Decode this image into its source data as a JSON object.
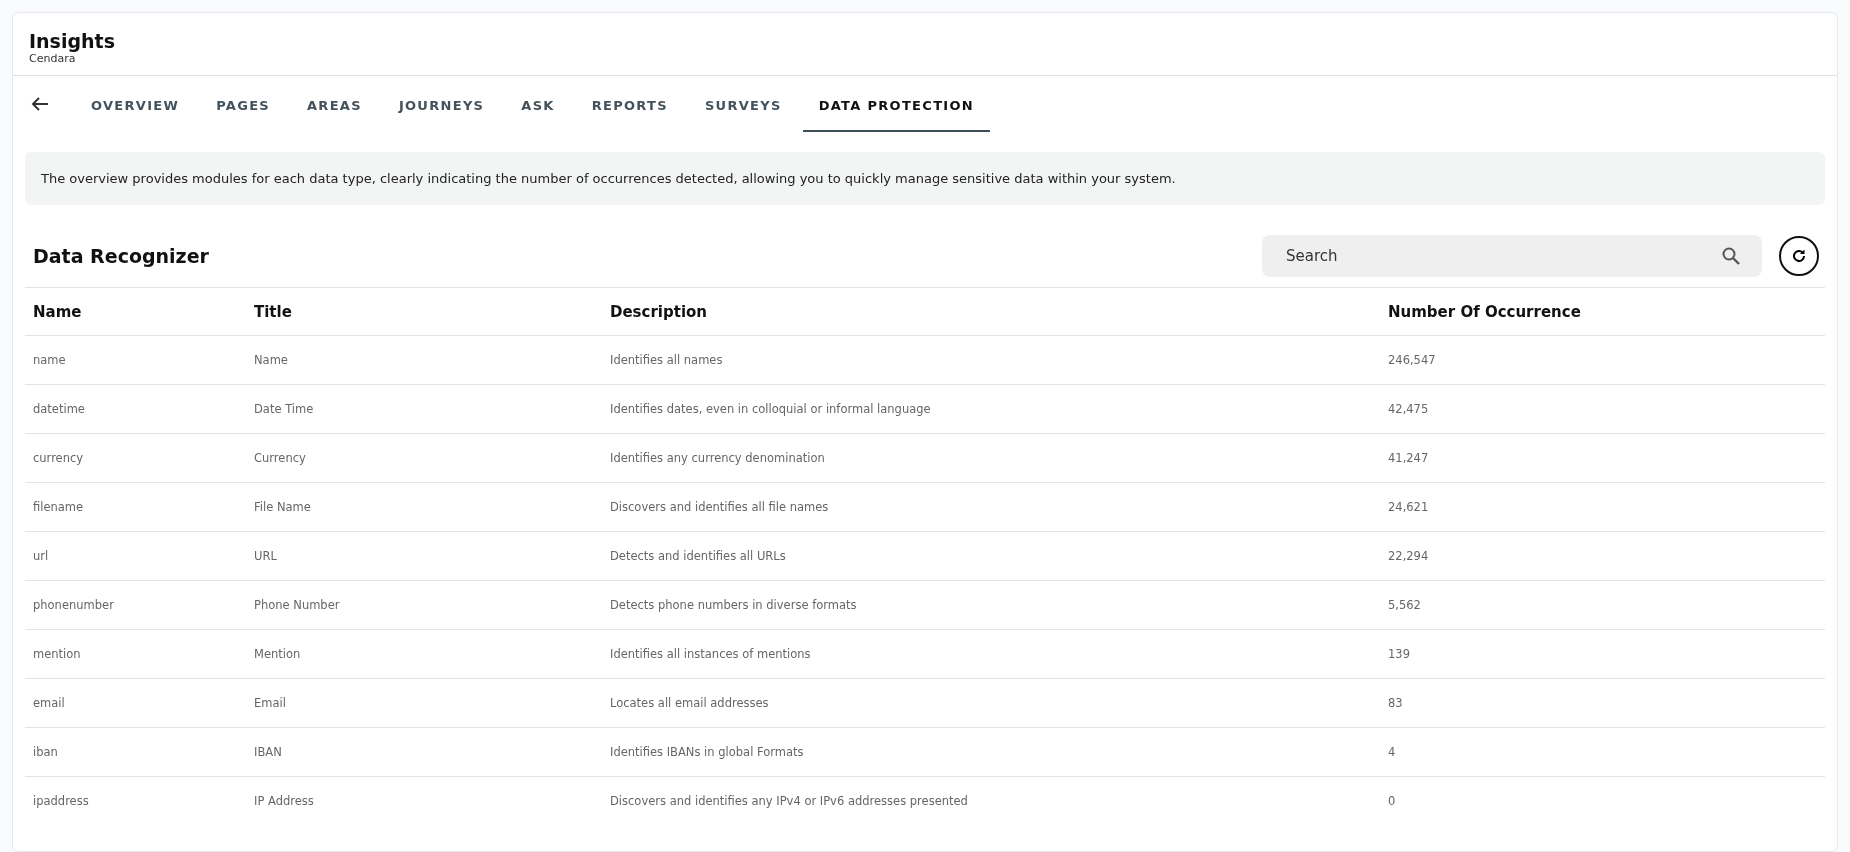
{
  "header": {
    "title": "Insights",
    "subtitle": "Cendara"
  },
  "tabs": [
    {
      "label": "OVERVIEW",
      "selected": false
    },
    {
      "label": "PAGES",
      "selected": false
    },
    {
      "label": "AREAS",
      "selected": false
    },
    {
      "label": "JOURNEYS",
      "selected": false
    },
    {
      "label": "ASK",
      "selected": false
    },
    {
      "label": "REPORTS",
      "selected": false
    },
    {
      "label": "SURVEYS",
      "selected": false
    },
    {
      "label": "DATA PROTECTION",
      "selected": true
    }
  ],
  "info": "The overview provides modules for each data type, clearly indicating the number of occurrences detected, allowing you to quickly manage sensitive data within your system.",
  "section_title": "Data Recognizer",
  "search": {
    "placeholder": "Search"
  },
  "table": {
    "columns": [
      "Name",
      "Title",
      "Description",
      "Number Of Occurrence"
    ],
    "rows": [
      [
        "name",
        "Name",
        "Identifies all names",
        "246,547"
      ],
      [
        "datetime",
        "Date Time",
        "Identifies dates, even in colloquial or informal language",
        "42,475"
      ],
      [
        "currency",
        "Currency",
        "Identifies any currency denomination",
        "41,247"
      ],
      [
        "filename",
        "File Name",
        "Discovers and identifies all file names",
        "24,621"
      ],
      [
        "url",
        "URL",
        "Detects and identifies all URLs",
        "22,294"
      ],
      [
        "phonenumber",
        "Phone Number",
        "Detects phone numbers in diverse formats",
        "5,562"
      ],
      [
        "mention",
        "Mention",
        "Identifies all instances of mentions",
        "139"
      ],
      [
        "email",
        "Email",
        "Locates all email addresses",
        "83"
      ],
      [
        "iban",
        "IBAN",
        "Identifies IBANs in global Formats",
        "4"
      ],
      [
        "ipaddress",
        "IP Address",
        "Discovers and identifies any IPv4 or IPv6 addresses presented",
        "0"
      ]
    ]
  }
}
